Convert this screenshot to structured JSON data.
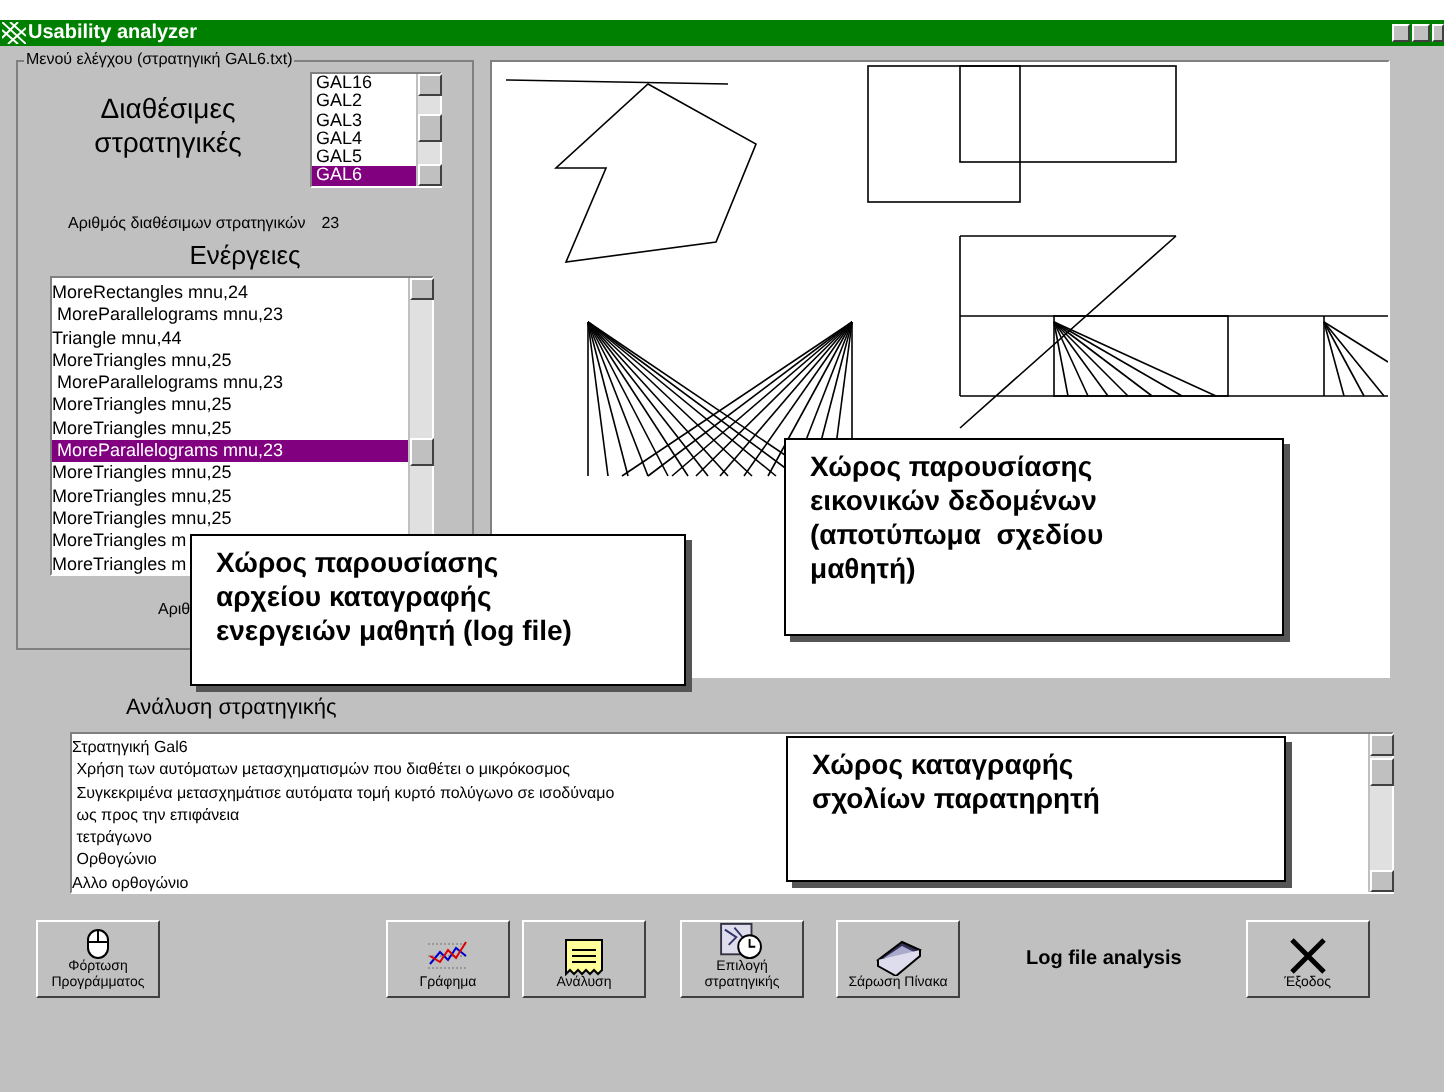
{
  "window": {
    "title": "Usability analyzer"
  },
  "control_menu": {
    "group_title": "Μενού ελέγχου (στρατηγική GAL6.txt)",
    "strategies_label": "Διαθέσιμες στρατηγικές",
    "strategies": [
      {
        "label": "GAL16",
        "selected": false
      },
      {
        "label": "GAL2",
        "selected": false
      },
      {
        "label": "GAL3",
        "selected": false
      },
      {
        "label": "GAL4",
        "selected": false
      },
      {
        "label": "GAL5",
        "selected": false
      },
      {
        "label": "GAL6",
        "selected": true
      }
    ],
    "strategy_count_label": "Αριθμός διαθέσιμων στρατηγικών",
    "strategy_count": "23",
    "actions_label": "Ενέργειες",
    "actions": [
      {
        "label": "MoreRectangles mnu,24",
        "selected": false
      },
      {
        "label": " MoreParallelograms mnu,23",
        "selected": false
      },
      {
        "label": "Triangle mnu,44",
        "selected": false
      },
      {
        "label": "MoreTriangles mnu,25",
        "selected": false
      },
      {
        "label": " MoreParallelograms mnu,23",
        "selected": false
      },
      {
        "label": "MoreTriangles mnu,25",
        "selected": false
      },
      {
        "label": "MoreTriangles mnu,25",
        "selected": false
      },
      {
        "label": " MoreParallelograms mnu,23",
        "selected": true
      },
      {
        "label": "MoreTriangles mnu,25",
        "selected": false
      },
      {
        "label": "MoreTriangles mnu,25",
        "selected": false
      },
      {
        "label": "MoreTriangles mnu,25",
        "selected": false
      },
      {
        "label": "MoreTriangles m",
        "selected": false
      },
      {
        "label": "MoreTriangles m",
        "selected": false
      }
    ],
    "count_label_partial": "Αριθ"
  },
  "analysis": {
    "label": "Ανάλυση στρατηγικής",
    "lines": [
      "Στρατηγική Gal6",
      " Χρήση των αυτόματων μετασχηματισμών που διαθέτει ο μικρόκοσμος",
      " Συγκεκριμένα μετασχημάτισε αυτόματα τομή κυρτό πολύγωνο σε ισοδύναμο",
      " ως προς την επιφάνεια",
      " τετράγωνο",
      " Ορθογώνιο",
      "Αλλο ορθογώνιο"
    ]
  },
  "buttons": [
    {
      "label": "Φόρτωση\nΠρογράμματος",
      "kind": "mouse"
    },
    {
      "label": "Γράφημα",
      "kind": "chart"
    },
    {
      "label": "Ανάλυση",
      "kind": "note"
    },
    {
      "label": "Επιλογή\nστρατηγικής",
      "kind": "clock"
    },
    {
      "label": "Σάρωση Πίνακα",
      "kind": "scanner"
    },
    {
      "label": "Έξοδος",
      "kind": "exit"
    }
  ],
  "status_text": "Log file analysis",
  "callouts": [
    "Χώρος παρουσίασης\nαρχείου καταγραφής\nενεργειών μαθητή (log file)",
    "Χώρος παρουσίασης\nεικονικών δεδομένων\n(αποτύπωμα  σχεδίου\nμαθητή)",
    "Χώρος καταγραφής\nσχολίων παρατηρητή"
  ]
}
